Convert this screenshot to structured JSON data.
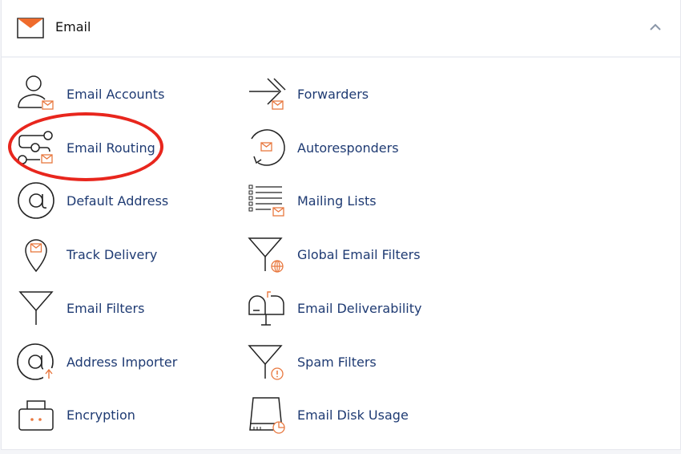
{
  "header": {
    "title": "Email",
    "icon": "envelope-icon",
    "collapse_icon": "chevron-up-icon"
  },
  "colors": {
    "link": "#1f3b73",
    "accent": "#e8783f",
    "highlight": "#e8261d"
  },
  "left": [
    {
      "label": "Email Accounts",
      "icon": "user-envelope-icon"
    },
    {
      "label": "Email Routing",
      "icon": "routing-icon"
    },
    {
      "label": "Default Address",
      "icon": "at-icon"
    },
    {
      "label": "Track Delivery",
      "icon": "location-pin-icon"
    },
    {
      "label": "Email Filters",
      "icon": "filter-icon"
    },
    {
      "label": "Address Importer",
      "icon": "at-import-icon"
    },
    {
      "label": "Encryption",
      "icon": "lock-box-icon"
    }
  ],
  "right": [
    {
      "label": "Forwarders",
      "icon": "forward-arrow-icon"
    },
    {
      "label": "Autoresponders",
      "icon": "auto-reply-icon"
    },
    {
      "label": "Mailing Lists",
      "icon": "list-icon"
    },
    {
      "label": "Global Email Filters",
      "icon": "global-filter-icon"
    },
    {
      "label": "Email Deliverability",
      "icon": "mailbox-icon"
    },
    {
      "label": "Spam Filters",
      "icon": "spam-filter-icon"
    },
    {
      "label": "Email Disk Usage",
      "icon": "disk-usage-icon"
    }
  ]
}
